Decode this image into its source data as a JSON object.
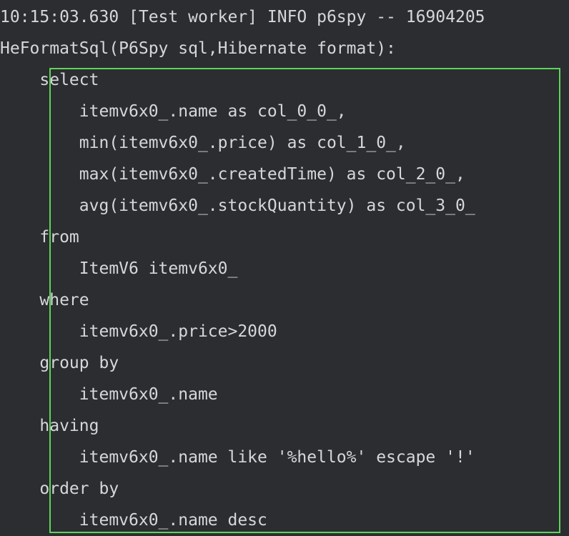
{
  "console": {
    "log_header": "10:15:03.630 [Test worker] INFO p6spy -- 16904205",
    "formatter_label": "HeFormatSql(P6Spy sql,Hibernate format):",
    "sql_lines": [
      "    select",
      "        itemv6x0_.name as col_0_0_,",
      "        min(itemv6x0_.price) as col_1_0_,",
      "        max(itemv6x0_.createdTime) as col_2_0_,",
      "        avg(itemv6x0_.stockQuantity) as col_3_0_",
      "    from",
      "        ItemV6 itemv6x0_",
      "    where",
      "        itemv6x0_.price>2000",
      "    group by",
      "        itemv6x0_.name",
      "    having",
      "        itemv6x0_.name like '%hello%' escape '!'",
      "    order by",
      "        itemv6x0_.name desc"
    ]
  },
  "colors": {
    "background": "#2b2d30",
    "text": "#d5d7da",
    "highlight_border": "#5fd35a"
  }
}
